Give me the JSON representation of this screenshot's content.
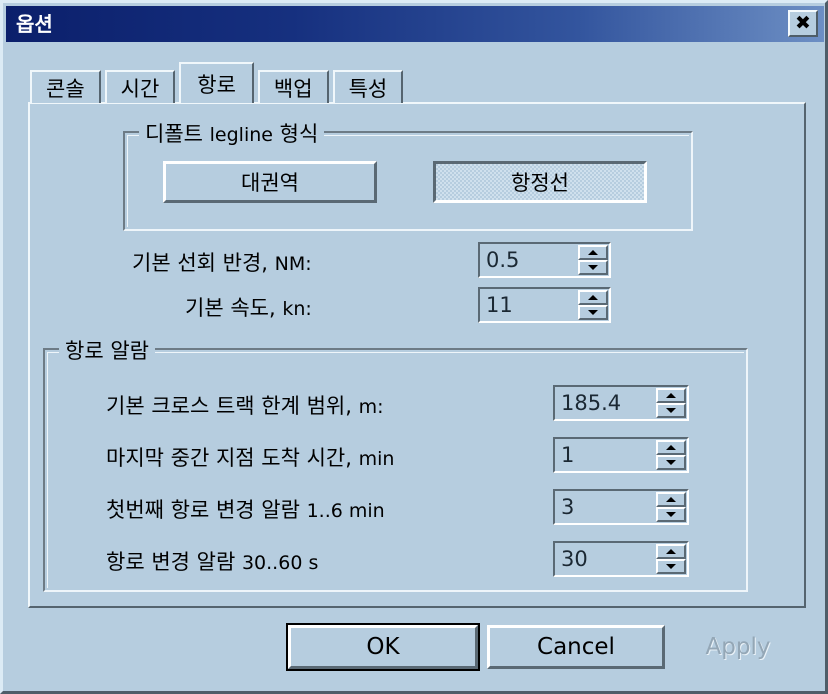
{
  "window": {
    "title": "옵션",
    "close_icon": "close-x-icon"
  },
  "tabs": [
    {
      "label": "콘솔",
      "active": false
    },
    {
      "label": "시간",
      "active": false
    },
    {
      "label": "항로",
      "active": true
    },
    {
      "label": "백업",
      "active": false
    },
    {
      "label": "특성",
      "active": false
    }
  ],
  "legline_group": {
    "label_ko_prefix": "디폴트",
    "label_en": "legline",
    "label_ko_suffix": "형식",
    "buttons": {
      "great_circle": "대권역",
      "rhumb_line": "항정선",
      "selected": "항정선"
    }
  },
  "defaults": {
    "turn_radius": {
      "label_ko": "기본 선회 반경,",
      "label_unit": "NM:",
      "value": "0.5"
    },
    "speed": {
      "label_ko": "기본 속도,",
      "label_unit": "kn:",
      "value": "11"
    }
  },
  "alarm_group": {
    "label": "항로 알람",
    "rows": [
      {
        "label_ko": "기본 크로스 트랙 한계 범위,",
        "label_unit": "m:",
        "value": "185.4"
      },
      {
        "label_ko": "마지막 중간 지점 도착 시간,",
        "label_unit": "min",
        "value": "1"
      },
      {
        "label_ko": "첫번째 항로 변경 알람",
        "label_unit": "1..6 min",
        "value": "3"
      },
      {
        "label_ko": "항로 변경 알람",
        "label_unit": "30..60 s",
        "value": "30"
      }
    ]
  },
  "footer": {
    "ok": "OK",
    "cancel": "Cancel",
    "apply": "Apply"
  },
  "colors": {
    "dialog_face": "#b6cddf",
    "titlebar_start": "#0b1f6b",
    "titlebar_end": "#6d8fc4",
    "text": "#000000",
    "disabled_text": "#94a7b6"
  }
}
